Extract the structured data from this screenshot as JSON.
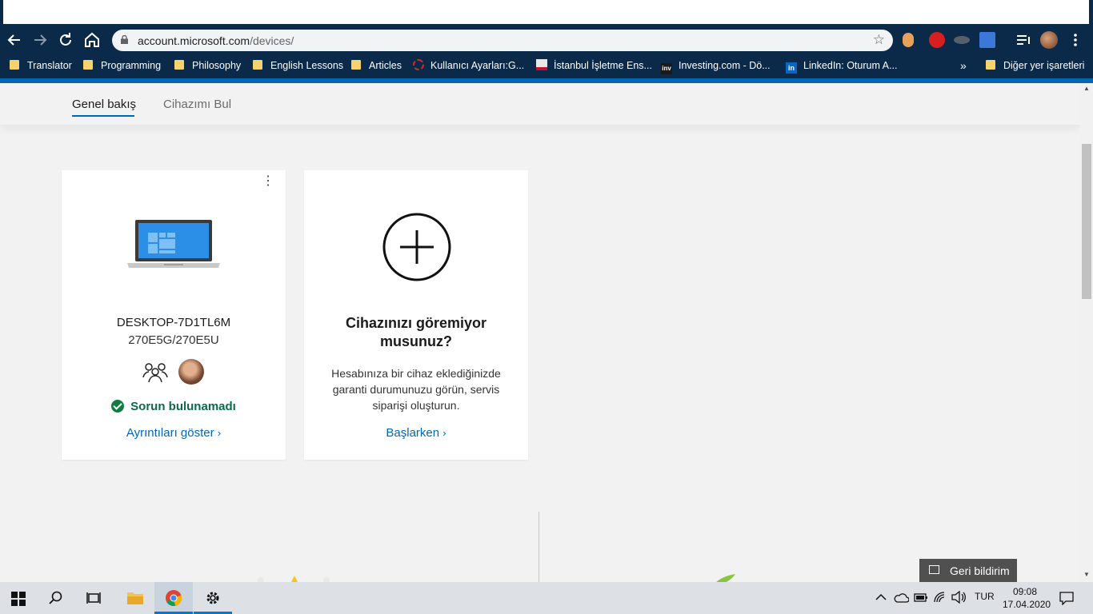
{
  "browser": {
    "url_host": "account.microsoft.com",
    "url_path": "/devices/",
    "bookmarks": [
      {
        "label": "Translator",
        "icon": "folder-icon"
      },
      {
        "label": "Programming",
        "icon": "folder-icon"
      },
      {
        "label": "Philosophy",
        "icon": "folder-icon"
      },
      {
        "label": "English Lessons",
        "icon": "folder-icon"
      },
      {
        "label": "Articles",
        "icon": "folder-icon"
      },
      {
        "label": "Kullanıcı Ayarları:G...",
        "icon": "settings-favicon"
      },
      {
        "label": "İstanbul İşletme Ens...",
        "icon": "university-favicon"
      },
      {
        "label": "Investing.com - Dö...",
        "icon": "investing-favicon"
      },
      {
        "label": "LinkedIn: Oturum A...",
        "icon": "linkedin-favicon"
      }
    ],
    "bookmarks_overflow": "»",
    "other_bookmarks": "Diğer yer işaretleri"
  },
  "subnav": {
    "tabs": [
      {
        "label": "Genel bakış",
        "active": true
      },
      {
        "label": "Cihazımı Bul",
        "active": false
      }
    ]
  },
  "device_card": {
    "name": "DESKTOP-7D1TL6M",
    "model": "270E5G/270E5U",
    "status": "Sorun bulunamadı",
    "link": "Ayrıntıları göster",
    "more": "⋮"
  },
  "add_card": {
    "title": "Cihazınızı göremiyor musunuz?",
    "description": "Hesabınıza bir cihaz eklediğinizde garanti durumunuzu görün, servis siparişi oluşturun.",
    "link": "Başlarken"
  },
  "feedback": {
    "label": "Geri bildirim"
  },
  "taskbar": {
    "language": "TUR",
    "time": "09:08",
    "date": "17.04.2020"
  },
  "colors": {
    "accent": "#0067b8",
    "status_green": "#107c41",
    "chrome_dark": "#0b2a4a"
  }
}
